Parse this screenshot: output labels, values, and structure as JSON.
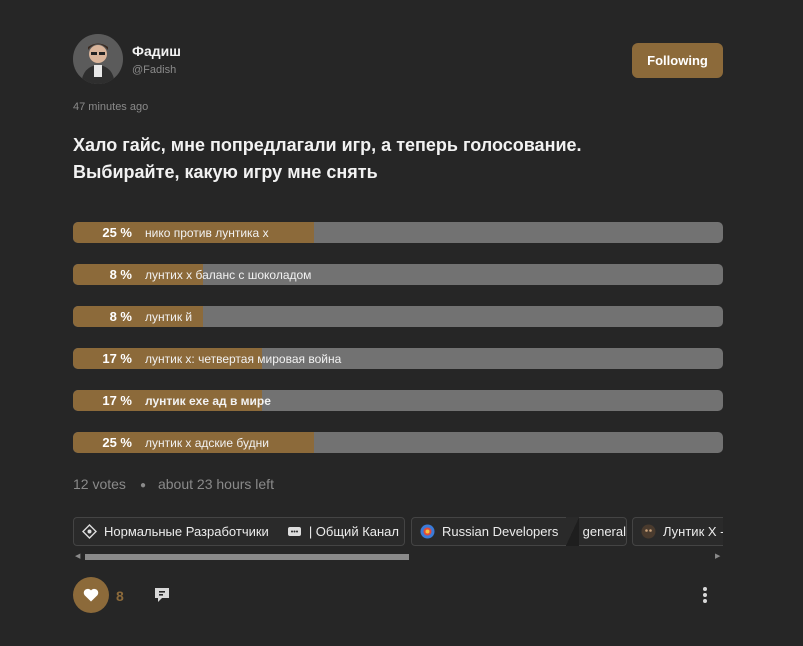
{
  "author": {
    "name": "Фадиш",
    "handle": "@Fadish"
  },
  "follow_label": "Following",
  "timestamp": "47 minutes ago",
  "title_line1": "Хало гайс, мне попредлагали игр, а теперь голосование.",
  "title_line2": "Выбирайте, какую игру мне снять",
  "poll": {
    "options": [
      {
        "percent": 25,
        "percent_label": "25 %",
        "label": "нико против лунтика х"
      },
      {
        "percent": 8,
        "percent_label": "8 %",
        "label": "лунтих х баланс с шоколадом"
      },
      {
        "percent": 8,
        "percent_label": "8 %",
        "label": "лунтик й"
      },
      {
        "percent": 17,
        "percent_label": "17 %",
        "label": "лунтик х: четвертая мировая война"
      },
      {
        "percent": 17,
        "percent_label": "17 %",
        "label": "лунтик exe ад в мире"
      },
      {
        "percent": 25,
        "percent_label": "25 %",
        "label": "лунтик х адские будни"
      }
    ],
    "votes": "12 votes",
    "time_left": "about 23 hours left"
  },
  "chips": [
    {
      "community": "Нормальные Разработчики",
      "channel": "| Общий Канал"
    },
    {
      "community": "Russian Developers",
      "channel": "general"
    },
    {
      "community": "Лунтик X -"
    }
  ],
  "likes": "8",
  "colors": {
    "accent": "#8c6a3a",
    "background": "#262626",
    "bar_bg": "#727272"
  }
}
